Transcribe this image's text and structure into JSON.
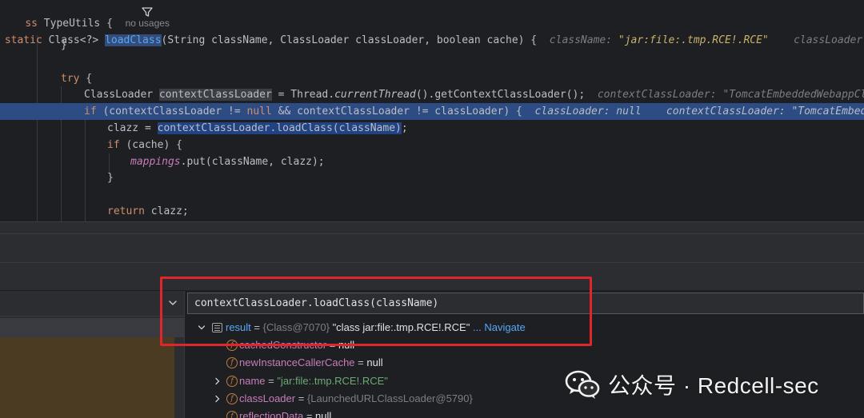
{
  "editor": {
    "line1": {
      "kw": "ss",
      "class_name": "TypeUtils",
      "brace": "{",
      "usages": "no usages"
    },
    "line2": {
      "kw": "static",
      "ret": "Class<?>",
      "method": "loadClass",
      "params": "(String className, ClassLoader classLoader, boolean cache) {",
      "hint1_label": "className:",
      "hint1_value": "\"jar:file:.tmp.RCE!.RCE\"",
      "hint2": "classLoader: null"
    },
    "line3": "}",
    "line5": {
      "kw": "try",
      "rest": " {"
    },
    "line6": {
      "type": "ClassLoader",
      "var": "contextClassLoader",
      "eq": " = Thread.",
      "call": "currentThread",
      "rest": "().getContextClassLoader();",
      "hint": "contextClassLoader: \"TomcatEmbeddedWebappClassLoad"
    },
    "line7": {
      "kw": "if",
      "p1": " (contextClassLoader != ",
      "null": "null",
      "p2": " && contextClassLoader != classLoader) {",
      "hint1": "classLoader: null",
      "hint2": "contextClassLoader: \"TomcatEmbeddedWeba"
    },
    "line8": {
      "pre": "clazz = ",
      "sel": "contextClassLoader.loadClass(className)",
      "post": ";"
    },
    "line9": {
      "kw": "if",
      "rest": " (cache) {"
    },
    "line10": {
      "field": "mappings",
      "rest": ".put(className, clazz);"
    },
    "line11": "}",
    "line13": {
      "kw": "return",
      "rest": " clazz;"
    }
  },
  "evaluate": {
    "expression": "contextClassLoader.loadClass(className)",
    "result": {
      "name": "result",
      "eq": " = ",
      "type": "{Class@7070}",
      "value": "\"class jar:file:.tmp.RCE!.RCE\"",
      "navigate": "... Navigate"
    },
    "fields": [
      {
        "name": "cachedConstructor",
        "eq": " = ",
        "value": "null",
        "type": "",
        "expandable": false
      },
      {
        "name": "newInstanceCallerCache",
        "eq": " = ",
        "value": "null",
        "type": "",
        "expandable": false
      },
      {
        "name": "name",
        "eq": " = ",
        "value": "\"jar:file:.tmp.RCE!.RCE\"",
        "type": "",
        "expandable": true
      },
      {
        "name": "classLoader",
        "eq": " = ",
        "value": "",
        "type": "{LaunchedURLClassLoader@5790}",
        "expandable": true
      },
      {
        "name": "reflectionData",
        "eq": " = ",
        "value": "null",
        "type": "",
        "expandable": false
      }
    ]
  },
  "watermark": {
    "text": "公众号 · Redcell-sec"
  },
  "colors": {
    "highlight": "#2d4c84",
    "annotation": "#e0262a",
    "keyword": "#cf8e6d",
    "method": "#56a8f5",
    "field": "#c77dbb",
    "string": "#6aab73"
  }
}
